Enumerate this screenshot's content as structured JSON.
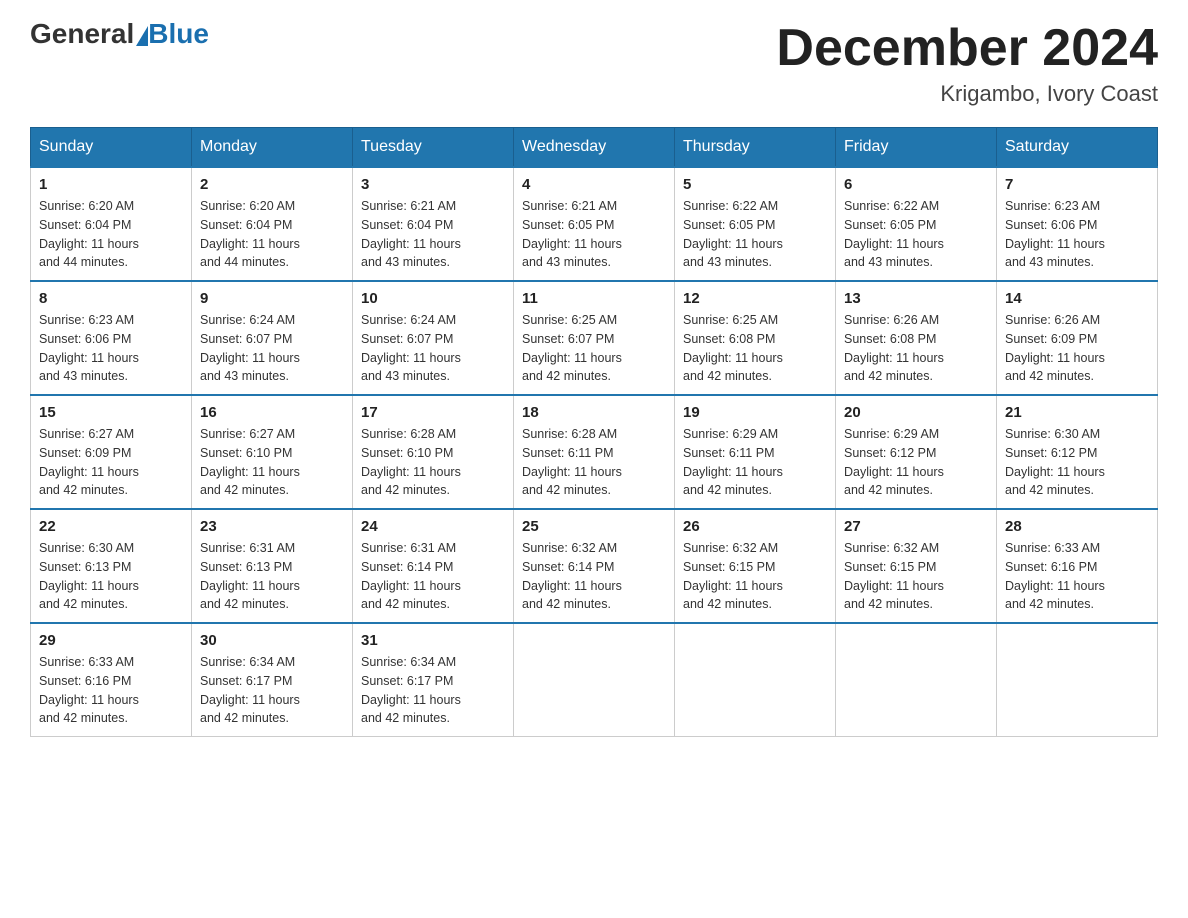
{
  "logo": {
    "general": "General",
    "blue": "Blue"
  },
  "header": {
    "month": "December 2024",
    "location": "Krigambo, Ivory Coast"
  },
  "days_of_week": [
    "Sunday",
    "Monday",
    "Tuesday",
    "Wednesday",
    "Thursday",
    "Friday",
    "Saturday"
  ],
  "weeks": [
    [
      {
        "day": "1",
        "sunrise": "6:20 AM",
        "sunset": "6:04 PM",
        "daylight": "11 hours and 44 minutes."
      },
      {
        "day": "2",
        "sunrise": "6:20 AM",
        "sunset": "6:04 PM",
        "daylight": "11 hours and 44 minutes."
      },
      {
        "day": "3",
        "sunrise": "6:21 AM",
        "sunset": "6:04 PM",
        "daylight": "11 hours and 43 minutes."
      },
      {
        "day": "4",
        "sunrise": "6:21 AM",
        "sunset": "6:05 PM",
        "daylight": "11 hours and 43 minutes."
      },
      {
        "day": "5",
        "sunrise": "6:22 AM",
        "sunset": "6:05 PM",
        "daylight": "11 hours and 43 minutes."
      },
      {
        "day": "6",
        "sunrise": "6:22 AM",
        "sunset": "6:05 PM",
        "daylight": "11 hours and 43 minutes."
      },
      {
        "day": "7",
        "sunrise": "6:23 AM",
        "sunset": "6:06 PM",
        "daylight": "11 hours and 43 minutes."
      }
    ],
    [
      {
        "day": "8",
        "sunrise": "6:23 AM",
        "sunset": "6:06 PM",
        "daylight": "11 hours and 43 minutes."
      },
      {
        "day": "9",
        "sunrise": "6:24 AM",
        "sunset": "6:07 PM",
        "daylight": "11 hours and 43 minutes."
      },
      {
        "day": "10",
        "sunrise": "6:24 AM",
        "sunset": "6:07 PM",
        "daylight": "11 hours and 43 minutes."
      },
      {
        "day": "11",
        "sunrise": "6:25 AM",
        "sunset": "6:07 PM",
        "daylight": "11 hours and 42 minutes."
      },
      {
        "day": "12",
        "sunrise": "6:25 AM",
        "sunset": "6:08 PM",
        "daylight": "11 hours and 42 minutes."
      },
      {
        "day": "13",
        "sunrise": "6:26 AM",
        "sunset": "6:08 PM",
        "daylight": "11 hours and 42 minutes."
      },
      {
        "day": "14",
        "sunrise": "6:26 AM",
        "sunset": "6:09 PM",
        "daylight": "11 hours and 42 minutes."
      }
    ],
    [
      {
        "day": "15",
        "sunrise": "6:27 AM",
        "sunset": "6:09 PM",
        "daylight": "11 hours and 42 minutes."
      },
      {
        "day": "16",
        "sunrise": "6:27 AM",
        "sunset": "6:10 PM",
        "daylight": "11 hours and 42 minutes."
      },
      {
        "day": "17",
        "sunrise": "6:28 AM",
        "sunset": "6:10 PM",
        "daylight": "11 hours and 42 minutes."
      },
      {
        "day": "18",
        "sunrise": "6:28 AM",
        "sunset": "6:11 PM",
        "daylight": "11 hours and 42 minutes."
      },
      {
        "day": "19",
        "sunrise": "6:29 AM",
        "sunset": "6:11 PM",
        "daylight": "11 hours and 42 minutes."
      },
      {
        "day": "20",
        "sunrise": "6:29 AM",
        "sunset": "6:12 PM",
        "daylight": "11 hours and 42 minutes."
      },
      {
        "day": "21",
        "sunrise": "6:30 AM",
        "sunset": "6:12 PM",
        "daylight": "11 hours and 42 minutes."
      }
    ],
    [
      {
        "day": "22",
        "sunrise": "6:30 AM",
        "sunset": "6:13 PM",
        "daylight": "11 hours and 42 minutes."
      },
      {
        "day": "23",
        "sunrise": "6:31 AM",
        "sunset": "6:13 PM",
        "daylight": "11 hours and 42 minutes."
      },
      {
        "day": "24",
        "sunrise": "6:31 AM",
        "sunset": "6:14 PM",
        "daylight": "11 hours and 42 minutes."
      },
      {
        "day": "25",
        "sunrise": "6:32 AM",
        "sunset": "6:14 PM",
        "daylight": "11 hours and 42 minutes."
      },
      {
        "day": "26",
        "sunrise": "6:32 AM",
        "sunset": "6:15 PM",
        "daylight": "11 hours and 42 minutes."
      },
      {
        "day": "27",
        "sunrise": "6:32 AM",
        "sunset": "6:15 PM",
        "daylight": "11 hours and 42 minutes."
      },
      {
        "day": "28",
        "sunrise": "6:33 AM",
        "sunset": "6:16 PM",
        "daylight": "11 hours and 42 minutes."
      }
    ],
    [
      {
        "day": "29",
        "sunrise": "6:33 AM",
        "sunset": "6:16 PM",
        "daylight": "11 hours and 42 minutes."
      },
      {
        "day": "30",
        "sunrise": "6:34 AM",
        "sunset": "6:17 PM",
        "daylight": "11 hours and 42 minutes."
      },
      {
        "day": "31",
        "sunrise": "6:34 AM",
        "sunset": "6:17 PM",
        "daylight": "11 hours and 42 minutes."
      },
      null,
      null,
      null,
      null
    ]
  ],
  "labels": {
    "sunrise": "Sunrise:",
    "sunset": "Sunset:",
    "daylight": "Daylight:"
  }
}
